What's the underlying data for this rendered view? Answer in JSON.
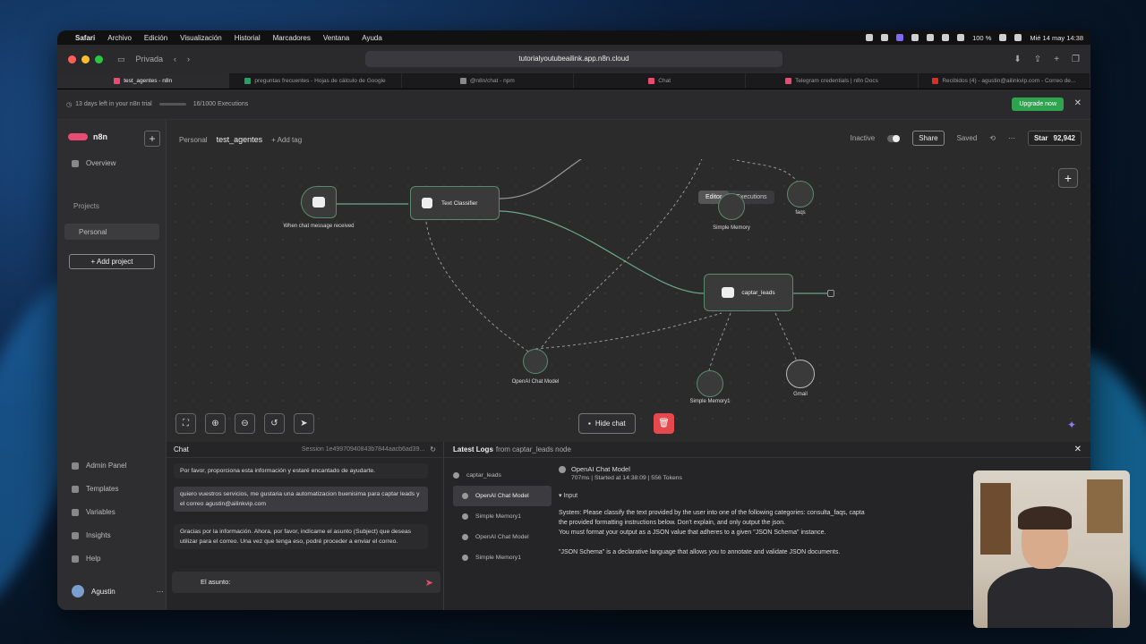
{
  "menubar": {
    "app": "Safari",
    "items": [
      "Archivo",
      "Edición",
      "Visualización",
      "Historial",
      "Marcadores",
      "Ventana",
      "Ayuda"
    ],
    "battery": "100 %",
    "datetime": "Mié 14 may 14:38"
  },
  "browser": {
    "private_label": "Privada",
    "url": "tutorialyoutubeailink.app.n8n.cloud",
    "tabs": [
      {
        "label": "test_agentes - n8n",
        "color": "#ea4b71"
      },
      {
        "label": "preguntas frecuentes - Hojas de cálculo de Google",
        "color": "#1fa463"
      },
      {
        "label": "@n8n/chat - npm",
        "color": "#888888"
      },
      {
        "label": "Chat",
        "color": "#ea4b71"
      },
      {
        "label": "Telegram credentials | n8n Docs",
        "color": "#ea4b71"
      },
      {
        "label": "Recibidos (4) - agustin@ailinkvip.com - Correo de...",
        "color": "#d93025"
      }
    ]
  },
  "trial": {
    "days_left": "13 days left in your n8n trial",
    "executions": "16/1000 Executions",
    "upgrade": "Upgrade now"
  },
  "sidebar": {
    "brand": "n8n",
    "overview": "Overview",
    "projects_heading": "Projects",
    "personal": "Personal",
    "add_project": "+ Add project",
    "bottom": [
      "Admin Panel",
      "Templates",
      "Variables",
      "Insights",
      "Help"
    ],
    "user": "Agustin"
  },
  "header": {
    "project": "Personal",
    "workflow": "test_agentes",
    "add_tag": "+ Add tag",
    "status": "Inactive",
    "share": "Share",
    "saved": "Saved",
    "star": "Star",
    "stars": "92,942",
    "tab_editor": "Editor",
    "tab_executions": "Executions"
  },
  "nodes": {
    "trigger": "When chat message received",
    "classifier": "Text Classifier",
    "simple_memory": "Simple Memory",
    "faqs": "faqs",
    "captar_leads": "captar_leads",
    "openai": "OpenAI Chat Model",
    "simple_memory1": "Simple Memory1",
    "gmail": "Gmail"
  },
  "canvas": {
    "hide_chat": "Hide chat"
  },
  "chat": {
    "title": "Chat",
    "session": "Session 1e49970940843b7844aacb6ad39...",
    "messages": [
      {
        "role": "bot",
        "text": "Por favor, proporciona esta información y estaré encantado de ayudarte."
      },
      {
        "role": "user",
        "text": "quiero vuestros servicios, me gustaria una automatizacion buenisima para captar leads y el correo agustin@ailinkvip.com"
      },
      {
        "role": "bot",
        "text": "Gracias por la información. Ahora, por favor, indícame el asunto (Subject) que deseas utilizar para el correo. Una vez que tenga eso, podré proceder a enviar el correo."
      }
    ],
    "input_value": "El asunto:"
  },
  "logs": {
    "title": "Latest Logs",
    "from": "from captar_leads node",
    "tree": [
      "captar_leads",
      "OpenAI Chat Model",
      "Simple Memory1",
      "OpenAI Chat Model",
      "Simple Memory1"
    ],
    "detail_title": "OpenAI Chat Model",
    "detail_meta": "707ms | Started at 14:38:09 | 556 Tokens",
    "input_label": "Input",
    "body_lines": [
      "System: Please classify the text provided by the user into one of the following categories: consulta_faqs, capta",
      "the provided formatting instructions below. Don't explain, and only output the json.",
      "You must format your output as a JSON value that adheres to a given \"JSON Schema\" instance.",
      "",
      "\"JSON Schema\" is a declarative language that allows you to annotate and validate JSON documents."
    ]
  }
}
